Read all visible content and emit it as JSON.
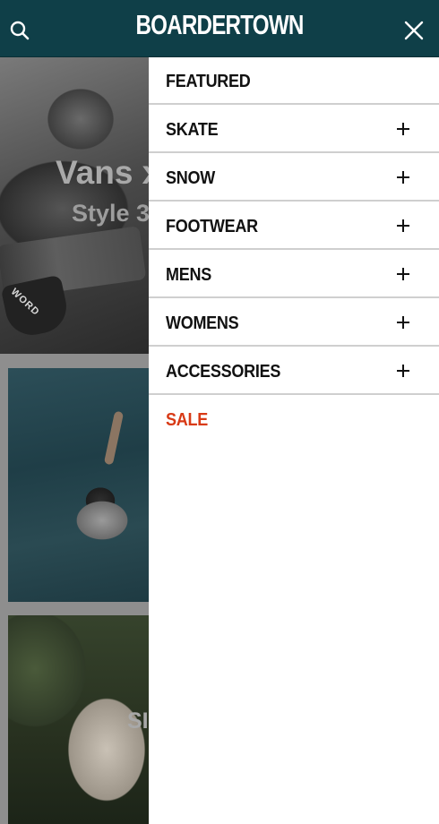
{
  "header": {
    "logo_text": "BOARDERTOWN",
    "search_icon": "search-icon",
    "close_icon": "close-icon",
    "background_color": "#0f3f48"
  },
  "background": {
    "hero_title": "Vans x",
    "hero_subtitle": "Style 3",
    "skate_shoe_text": "WORD",
    "card2_text": "SI"
  },
  "menu": {
    "items": [
      {
        "label": "FEATURED",
        "expandable": false
      },
      {
        "label": "SKATE",
        "expandable": true
      },
      {
        "label": "SNOW",
        "expandable": true
      },
      {
        "label": "FOOTWEAR",
        "expandable": true
      },
      {
        "label": "MENS",
        "expandable": true
      },
      {
        "label": "WOMENS",
        "expandable": true
      },
      {
        "label": "ACCESSORIES",
        "expandable": true
      },
      {
        "label": "SALE",
        "expandable": false
      }
    ],
    "sale_color": "#d83a16",
    "expand_icon": "plus-icon"
  }
}
